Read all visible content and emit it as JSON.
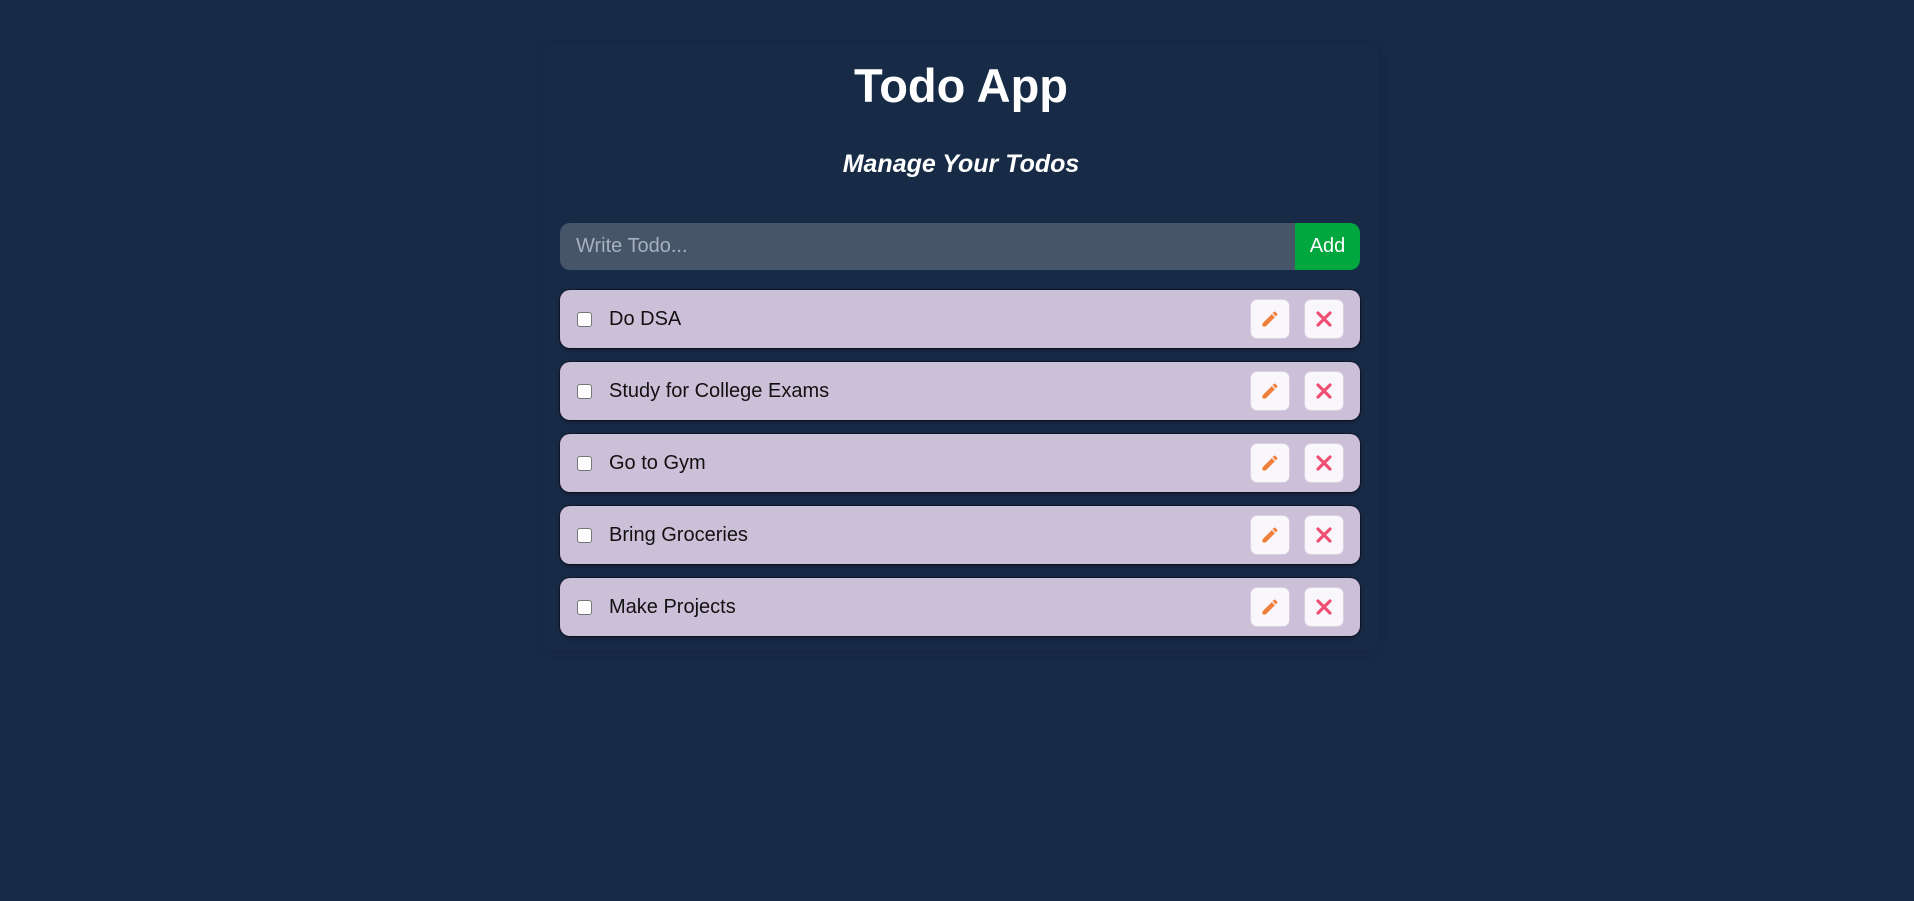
{
  "header": {
    "title": "Todo App",
    "subtitle": "Manage Your Todos"
  },
  "form": {
    "input_placeholder": "Write Todo...",
    "input_value": "",
    "add_label": "Add"
  },
  "colors": {
    "background": "#172a46",
    "input_bg": "#475569",
    "add_button": "#00a63e",
    "todo_bg": "#ccc0d9",
    "edit_icon": "#f07f3a",
    "delete_icon": "#ef4f72"
  },
  "icons": {
    "edit": "pencil-icon",
    "delete": "close-icon"
  },
  "todos": [
    {
      "text": "Do DSA",
      "completed": false
    },
    {
      "text": "Study for College Exams",
      "completed": false
    },
    {
      "text": "Go to Gym",
      "completed": false
    },
    {
      "text": "Bring Groceries",
      "completed": false
    },
    {
      "text": "Make Projects",
      "completed": false
    }
  ]
}
